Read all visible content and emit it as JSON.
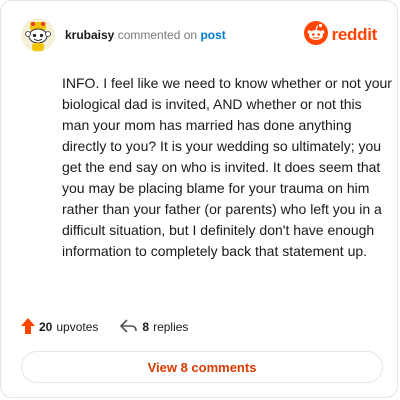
{
  "header": {
    "username": "krubaisy",
    "action_text": "commented on",
    "post_link": "post",
    "avatar_icon": "yellow-snoo-avatar-icon"
  },
  "brand": {
    "icon": "reddit-snoo-icon",
    "wordmark": "reddit",
    "color": "#ff4500"
  },
  "comment": {
    "text": "INFO. I feel like we need to know whether or not your biological dad is invited, AND whether or not this man your mom has married has done anything directly to you? It is your wedding so ultimately; you get the end say on who is invited. It does seem that you may be placing blame for your trauma on him rather than your father (or parents) who left you in a difficult situation, but I definitely don't have enough information to completely back that statement up."
  },
  "actions": {
    "upvotes_count": "20",
    "upvotes_label": "upvotes",
    "upvote_icon": "upvote-arrow-icon",
    "replies_count": "8",
    "replies_label": "replies",
    "reply_icon": "reply-arrow-icon"
  },
  "footer": {
    "view_comments_label": "View 8 comments"
  },
  "colors": {
    "accent": "#ff4500",
    "link": "#0079d3",
    "button_text": "#d93a00",
    "muted": "#787c7e"
  }
}
